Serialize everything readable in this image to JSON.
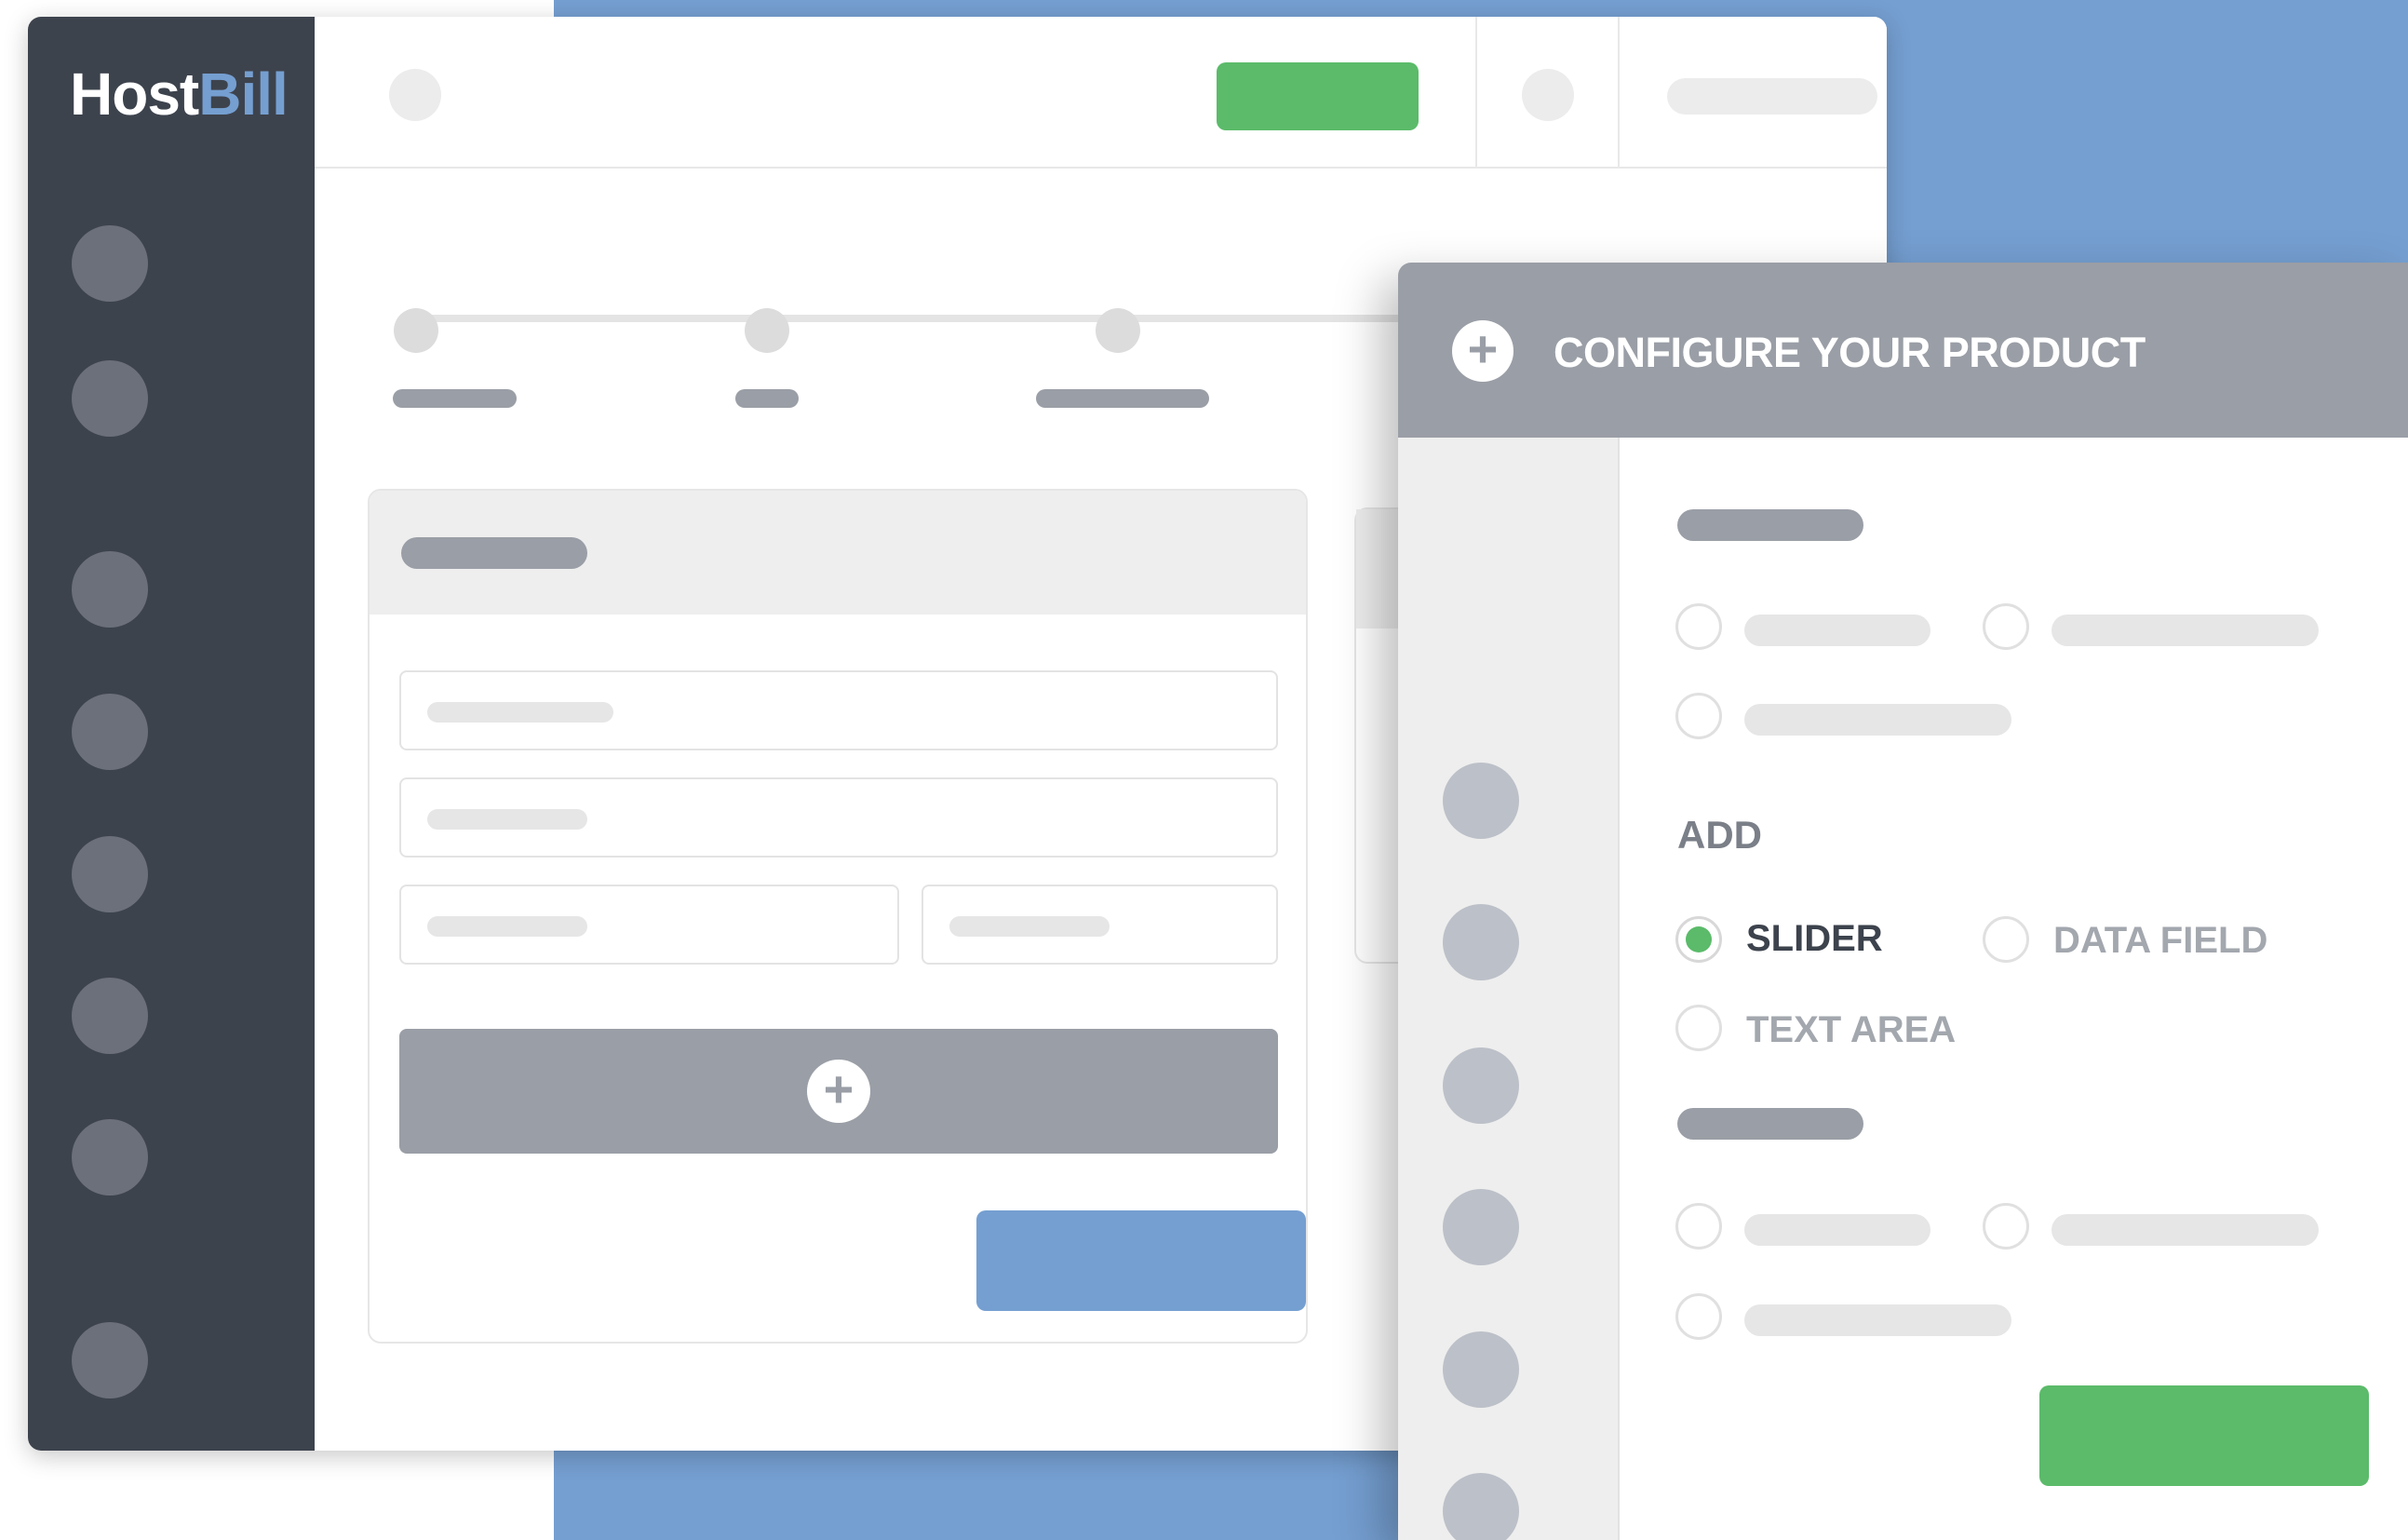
{
  "app": {
    "logo_host": "Host",
    "logo_bill": "Bill"
  },
  "panel": {
    "title": "CONFIGURE YOUR PRODUCT",
    "add_label": "ADD",
    "options": [
      {
        "label": "SLIDER",
        "selected": true
      },
      {
        "label": "DATA FIELD",
        "selected": false
      },
      {
        "label": "TEXT AREA",
        "selected": false
      }
    ]
  },
  "icons": {
    "add": "+"
  },
  "colors": {
    "sidebar": "#3d434d",
    "accent_blue": "#759fd1",
    "accent_green": "#5bbb6a",
    "panel_header": "#9a9ea6"
  }
}
